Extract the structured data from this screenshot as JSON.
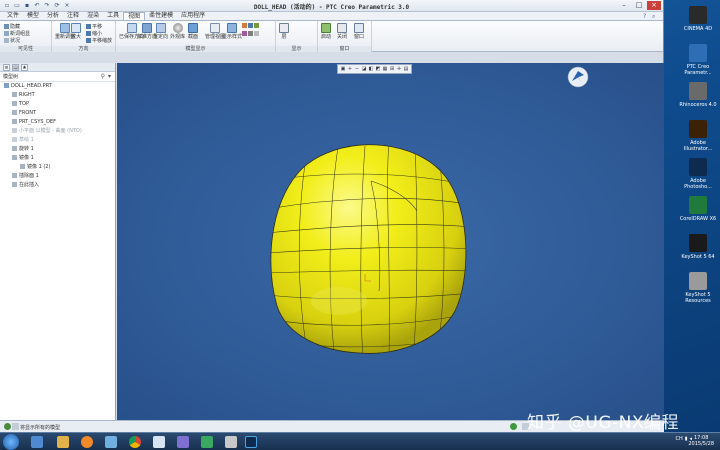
{
  "window": {
    "title": "DOLL_HEAD (活动的) - PTC Creo Parametric 3.0"
  },
  "menu_tabs": [
    "文件",
    "模型",
    "分析",
    "注释",
    "渲染",
    "工具",
    "视图",
    "柔性建模",
    "应用程序"
  ],
  "active_tab": "视图",
  "ribbon": {
    "small_buttons": [
      "隐藏",
      "新词组显",
      "状况"
    ],
    "large_buttons": [
      "重新调整",
      "放大",
      "平移",
      "缩小",
      "平移缩放",
      "已保存方向",
      "标准方向",
      "重定向",
      "外观库",
      "截面",
      "管理视图",
      "显示样式",
      "层",
      "启动",
      "关闭",
      "窗口"
    ],
    "group_labels": [
      "可见性",
      "方向",
      "模型显示",
      "显示",
      "窗口"
    ]
  },
  "panel": {
    "section_label": "模型树",
    "tree": [
      {
        "label": "DOLL_HEAD.PRT",
        "level": 0,
        "dim": false
      },
      {
        "label": "RIGHT",
        "level": 1,
        "dim": false
      },
      {
        "label": "TOP",
        "level": 1,
        "dim": false
      },
      {
        "label": "FRONT",
        "level": 1,
        "dim": false
      },
      {
        "label": "PRT_CSYS_DEF",
        "level": 1,
        "dim": false
      },
      {
        "label": "小平面 以模型 - 曲面 (NTO)",
        "level": 1,
        "dim": true
      },
      {
        "label": "草绘 1",
        "level": 1,
        "dim": true
      },
      {
        "label": "旋转 1",
        "level": 1,
        "dim": false
      },
      {
        "label": "镜像 1",
        "level": 1,
        "dim": false
      },
      {
        "label": "镜像 1 (2)",
        "level": 2,
        "dim": false
      },
      {
        "label": "插除面 1",
        "level": 1,
        "dim": false
      },
      {
        "label": "在此插入",
        "level": 1,
        "dim": false
      }
    ]
  },
  "statusbar": {
    "message": "将显示所有的模型"
  },
  "desktop_icons": [
    {
      "label": "CINEMA 4D",
      "color": "#2a2a2a",
      "icon": "cinema4d-icon"
    },
    {
      "label": "PTC Creo Parametr...",
      "color": "#2d6eb5",
      "icon": "creo-icon"
    },
    {
      "label": "Rhinoceros 4.0",
      "color": "#6a6a6a",
      "icon": "rhino-icon"
    },
    {
      "label": "Adobe Illustrator...",
      "color": "#3b2106",
      "icon": "illustrator-icon"
    },
    {
      "label": "Adobe Photosho...",
      "color": "#0e2b4f",
      "icon": "photoshop-icon"
    },
    {
      "label": "CorelDRAW X6",
      "color": "#1f7a3c",
      "icon": "coreldraw-icon"
    },
    {
      "label": "KeyShot 5 64",
      "color": "#1a1a1a",
      "icon": "keyshot-icon"
    },
    {
      "label": "KeyShot 5 Resources",
      "color": "#9a9a9a",
      "icon": "keyshot-resources-icon"
    }
  ],
  "watermark": "知乎 @UG-NX编程",
  "taskbar": {
    "time": "17:08",
    "date": "2015/5/28",
    "tray_lang": "CH"
  },
  "colors": {
    "model_yellow": "#f2ee1a",
    "model_edge": "#2c2c12",
    "viewport_bg": "#2f5b97"
  }
}
